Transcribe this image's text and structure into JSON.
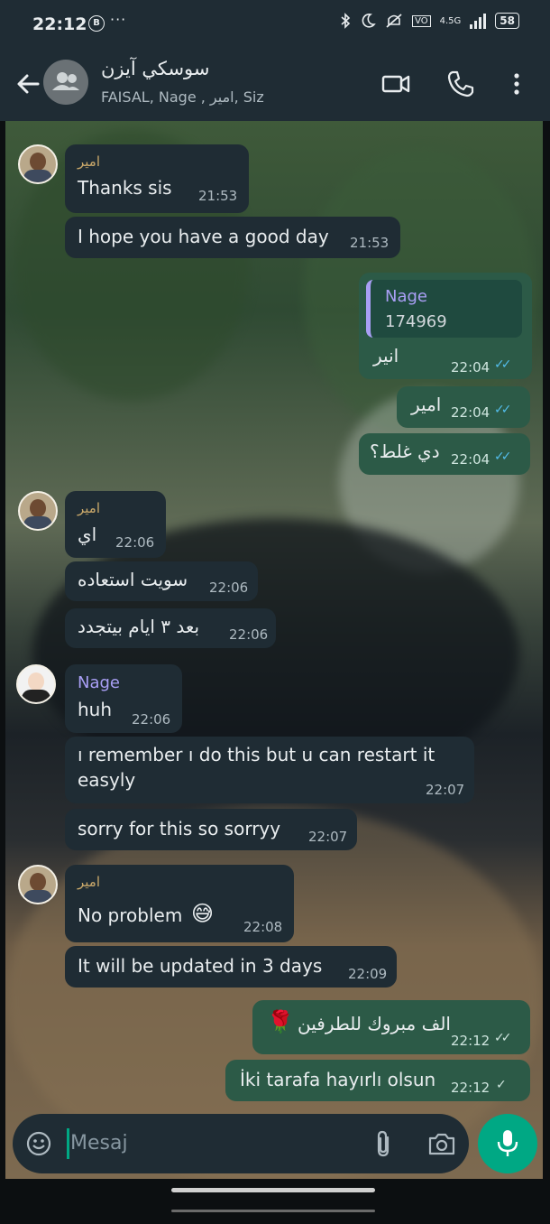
{
  "status_bar": {
    "time": "22:12",
    "b_badge": "B",
    "dots": "···",
    "network": "4.5G",
    "battery": "58",
    "icons": [
      "bluetooth-icon",
      "moon-icon",
      "mute-icon",
      "volte-icon",
      "signal-icon",
      "battery-icon"
    ]
  },
  "header": {
    "title": "سوسكي آيزن",
    "subtitle": "FAISAL, Nage , امير, Siz",
    "icons": [
      "back-arrow-icon",
      "group-avatar-icon",
      "video-call-icon",
      "phone-call-icon",
      "more-vert-icon"
    ]
  },
  "messages": [
    {
      "sender": "امير",
      "text": "Thanks sis",
      "time": "21:53"
    },
    {
      "text": "I hope you have a good day",
      "time": "21:53"
    },
    {
      "quote_name": "Nage",
      "quote_text": "174969",
      "text": "انير",
      "time": "22:04",
      "status": "read"
    },
    {
      "text": "امير",
      "time": "22:04",
      "status": "read"
    },
    {
      "text": "دي غلط؟",
      "time": "22:04",
      "status": "read"
    },
    {
      "sender": "امير",
      "text": "اي",
      "time": "22:06"
    },
    {
      "text": "سويت استعاده",
      "time": "22:06"
    },
    {
      "text": "بعد ٣ ايام بيتجدد",
      "time": "22:06"
    },
    {
      "sender": "Nage",
      "text": "huh",
      "time": "22:06"
    },
    {
      "text": "ı remember ı do this but u can restart it",
      "text2": "easyly",
      "time": "22:07"
    },
    {
      "text": "sorry for this so sorryy",
      "time": "22:07"
    },
    {
      "sender": "امير",
      "text": "No problem",
      "emoji": "😅",
      "time": "22:08"
    },
    {
      "text": "It will be updated in 3 days",
      "time": "22:09"
    },
    {
      "text": "الف مبروك للطرفين",
      "emoji": "🌹",
      "time": "22:12",
      "status": "delivered"
    },
    {
      "text": "İki tarafa hayırlı olsun",
      "time": "22:12",
      "status": "sent"
    }
  ],
  "composer": {
    "placeholder": "Mesaj",
    "icons": [
      "emoji-icon",
      "attach-icon",
      "camera-icon",
      "mic-icon"
    ]
  },
  "colors": {
    "incoming": "#1f2c34",
    "outgoing": "#005c4b",
    "accent": "#00a884",
    "read_tick": "#53bdeb"
  }
}
